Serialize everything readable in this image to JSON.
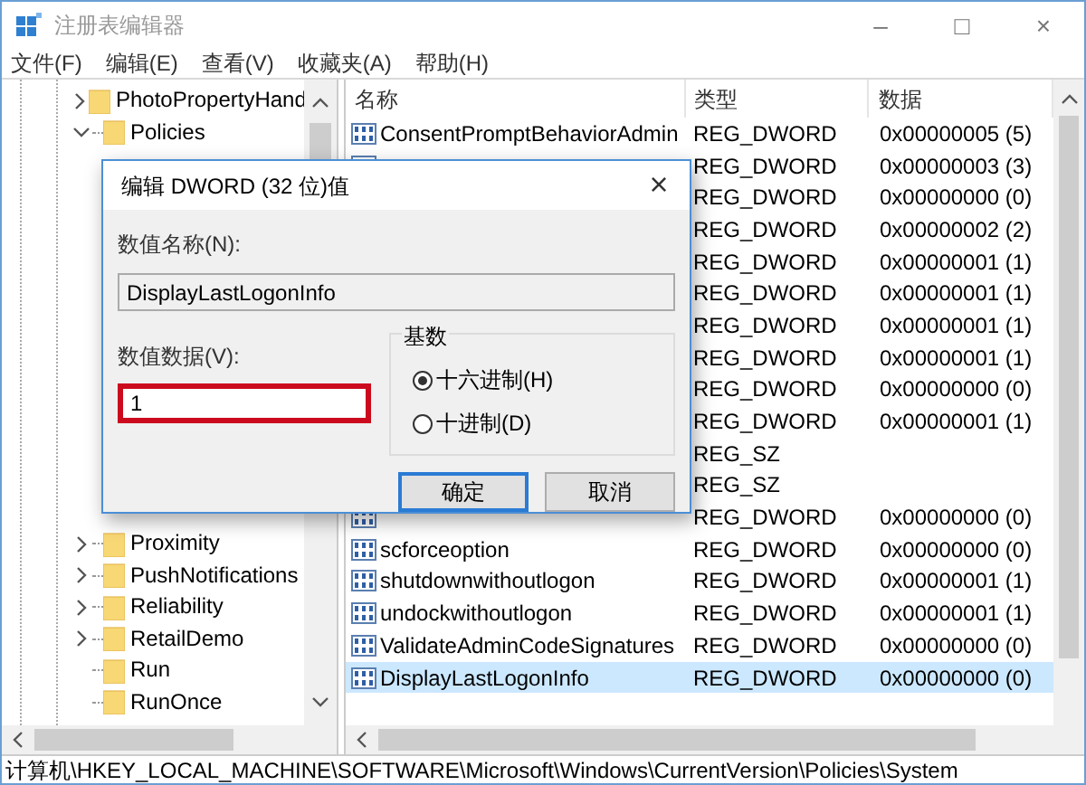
{
  "window": {
    "title": "注册表编辑器",
    "controls": [
      "–",
      "□",
      "×"
    ]
  },
  "menu": [
    "文件(F)",
    "编辑(E)",
    "查看(V)",
    "收藏夹(A)",
    "帮助(H)"
  ],
  "tree": {
    "items": [
      {
        "label": "PhotoPropertyHand",
        "kind": "branch",
        "expanded": false
      },
      {
        "label": "Policies",
        "kind": "branch",
        "expanded": true
      },
      {
        "label": "Proximity",
        "kind": "branch",
        "expanded": false
      },
      {
        "label": "PushNotifications",
        "kind": "branch",
        "expanded": false
      },
      {
        "label": "Reliability",
        "kind": "branch",
        "expanded": false
      },
      {
        "label": "RetailDemo",
        "kind": "branch",
        "expanded": false
      },
      {
        "label": "Run",
        "kind": "leaf"
      },
      {
        "label": "RunOnce",
        "kind": "leaf"
      }
    ]
  },
  "table": {
    "columns": [
      "名称",
      "类型",
      "数据"
    ],
    "rows": [
      {
        "name": "ConsentPromptBehaviorAdmin",
        "type": "REG_DWORD",
        "data": "0x00000005 (5)",
        "selected": false
      },
      {
        "type": "REG_DWORD",
        "data": "0x00000003 (3)",
        "selected": false
      },
      {
        "type": "REG_DWORD",
        "data": "0x00000000 (0)",
        "selected": false
      },
      {
        "type": "REG_DWORD",
        "data": "0x00000002 (2)",
        "selected": false
      },
      {
        "type": "REG_DWORD",
        "data": "0x00000001 (1)",
        "selected": false
      },
      {
        "type": "REG_DWORD",
        "data": "0x00000001 (1)",
        "selected": false
      },
      {
        "type": "REG_DWORD",
        "data": "0x00000001 (1)",
        "selected": false
      },
      {
        "type": "REG_DWORD",
        "data": "0x00000001 (1)",
        "selected": false
      },
      {
        "type": "REG_DWORD",
        "data": "0x00000000 (0)",
        "selected": false
      },
      {
        "type": "REG_DWORD",
        "data": "0x00000001 (1)",
        "selected": false
      },
      {
        "type": "REG_SZ",
        "selected": false
      },
      {
        "type": "REG_SZ",
        "selected": false
      },
      {
        "type": "REG_DWORD",
        "data": "0x00000000 (0)",
        "selected": false
      },
      {
        "name": "scforceoption",
        "type": "REG_DWORD",
        "data": "0x00000000 (0)",
        "selected": false
      },
      {
        "name": "shutdownwithoutlogon",
        "type": "REG_DWORD",
        "data": "0x00000001 (1)",
        "selected": false
      },
      {
        "name": "undockwithoutlogon",
        "type": "REG_DWORD",
        "data": "0x00000001 (1)",
        "selected": false
      },
      {
        "name": "ValidateAdminCodeSignatures",
        "type": "REG_DWORD",
        "data": "0x00000000 (0)",
        "selected": false
      },
      {
        "name": "DisplayLastLogonInfo",
        "type": "REG_DWORD",
        "data": "0x00000000 (0)",
        "selected": true
      }
    ]
  },
  "dialog": {
    "title": "编辑 DWORD (32 位)值",
    "close": "×",
    "name_label": "数值名称(N):",
    "name_value": "DisplayLastLogonInfo",
    "data_label": "数值数据(V):",
    "data_value": "1",
    "data_highlighted": true,
    "base": {
      "title": "基数",
      "options": [
        {
          "label": "十六进制(H)",
          "selected": true
        },
        {
          "label": "十进制(D)",
          "selected": false
        }
      ]
    },
    "buttons": [
      {
        "label": "确定",
        "focused": true
      },
      {
        "label": "取消",
        "focused": false
      }
    ]
  },
  "status_bar": "计算机\\HKEY_LOCAL_MACHINE\\SOFTWARE\\Microsoft\\Windows\\CurrentVersion\\Policies\\System"
}
